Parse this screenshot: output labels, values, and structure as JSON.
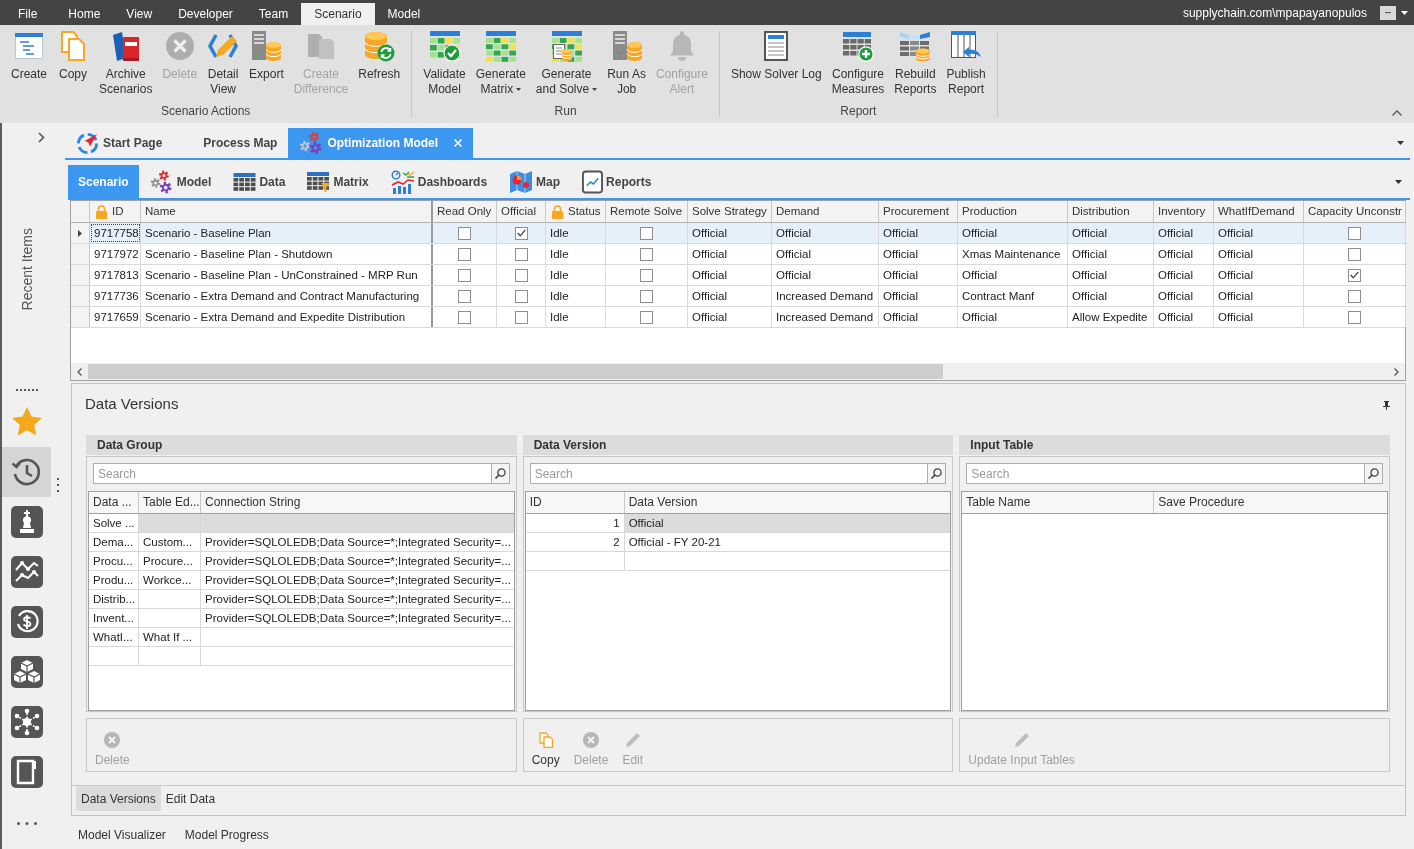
{
  "menu_bar": {
    "items": [
      {
        "label": "File",
        "selected": false
      },
      {
        "label": "Home",
        "selected": false
      },
      {
        "label": "View",
        "selected": false
      },
      {
        "label": "Developer",
        "selected": false
      },
      {
        "label": "Team",
        "selected": false
      },
      {
        "label": "Scenario",
        "selected": true
      },
      {
        "label": "Model",
        "selected": false
      }
    ],
    "user": "supplychain.com\\mpapayanopulos",
    "user_menu": "--"
  },
  "ribbon": {
    "groups": [
      {
        "label": "Scenario Actions",
        "buttons": [
          {
            "label": "Create",
            "disabled": false,
            "dropdown": false
          },
          {
            "label": "Copy",
            "disabled": false,
            "dropdown": false
          },
          {
            "label": "Archive\nScenarios",
            "disabled": false,
            "dropdown": false
          },
          {
            "label": "Delete",
            "disabled": true,
            "dropdown": false
          },
          {
            "label": "Detail\nView",
            "disabled": false,
            "dropdown": false
          },
          {
            "label": "Export",
            "disabled": false,
            "dropdown": false
          },
          {
            "label": "Create\nDifference",
            "disabled": true,
            "dropdown": false
          },
          {
            "label": "Refresh",
            "disabled": false,
            "dropdown": false
          }
        ]
      },
      {
        "label": "Run",
        "buttons": [
          {
            "label": "Validate\nModel",
            "disabled": false,
            "dropdown": false
          },
          {
            "label": "Generate\nMatrix",
            "disabled": false,
            "dropdown": true
          },
          {
            "label": "Generate\nand Solve",
            "disabled": false,
            "dropdown": true
          },
          {
            "label": "Run As\nJob",
            "disabled": false,
            "dropdown": false
          },
          {
            "label": "Configure\nAlert",
            "disabled": true,
            "dropdown": false
          }
        ]
      },
      {
        "label": "Report",
        "buttons": [
          {
            "label": "Show Solver Log",
            "disabled": false,
            "dropdown": false
          },
          {
            "label": "Configure\nMeasures",
            "disabled": false,
            "dropdown": false
          },
          {
            "label": "Rebuild\nReports",
            "disabled": false,
            "dropdown": false
          },
          {
            "label": "Publish\nReport",
            "disabled": false,
            "dropdown": false
          }
        ]
      }
    ]
  },
  "sidebar": {
    "label": "Recent Items",
    "items": [
      {
        "selected": false
      },
      {
        "selected": true
      },
      {
        "selected": false
      },
      {
        "selected": false
      },
      {
        "selected": false
      },
      {
        "selected": false
      },
      {
        "selected": false
      },
      {
        "selected": false
      }
    ]
  },
  "document_tabs": [
    {
      "label": "Start Page",
      "selected": false,
      "closable": false
    },
    {
      "label": "Process Map",
      "selected": false,
      "closable": false
    },
    {
      "label": "Optimization Model",
      "selected": true,
      "closable": true
    }
  ],
  "view_tabs": [
    {
      "label": "Scenario",
      "selected": true
    },
    {
      "label": "Model",
      "selected": false
    },
    {
      "label": "Data",
      "selected": false
    },
    {
      "label": "Matrix",
      "selected": false
    },
    {
      "label": "Dashboards",
      "selected": false
    },
    {
      "label": "Map",
      "selected": false
    },
    {
      "label": "Reports",
      "selected": false
    }
  ],
  "scenario_grid": {
    "columns": [
      {
        "label": "ID",
        "kind": "text",
        "locked": true
      },
      {
        "label": "Name",
        "kind": "text",
        "locked": false
      },
      {
        "label": "Read Only",
        "kind": "check",
        "locked": false
      },
      {
        "label": "Official",
        "kind": "check",
        "locked": false
      },
      {
        "label": "Status",
        "kind": "text",
        "locked": true
      },
      {
        "label": "Remote Solve",
        "kind": "check",
        "locked": false
      },
      {
        "label": "Solve Strategy",
        "kind": "text",
        "locked": false
      },
      {
        "label": "Demand",
        "kind": "text",
        "locked": false
      },
      {
        "label": "Procurement",
        "kind": "text",
        "locked": false
      },
      {
        "label": "Production",
        "kind": "text",
        "locked": false
      },
      {
        "label": "Distribution",
        "kind": "text",
        "locked": false
      },
      {
        "label": "Inventory",
        "kind": "text",
        "locked": false
      },
      {
        "label": "WhatIfDemand",
        "kind": "text",
        "locked": false
      },
      {
        "label": "Capacity Unconstr",
        "kind": "check",
        "locked": false
      }
    ],
    "rows": [
      {
        "selected": true,
        "cells": [
          "9717758",
          "Scenario - Baseline Plan",
          {
            "checked": false
          },
          {
            "checked": true
          },
          "Idle",
          {
            "checked": false
          },
          "Official",
          "Official",
          "Official",
          "Official",
          "Official",
          "Official",
          "Official",
          {
            "checked": false
          }
        ]
      },
      {
        "selected": false,
        "cells": [
          "9717972",
          "Scenario - Baseline Plan - Shutdown",
          {
            "checked": false
          },
          {
            "checked": false
          },
          "Idle",
          {
            "checked": false
          },
          "Official",
          "Official",
          "Official",
          "Xmas Maintenance",
          "Official",
          "Official",
          "Official",
          {
            "checked": false
          }
        ]
      },
      {
        "selected": false,
        "cells": [
          "9717813",
          "Scenario - Baseline Plan - UnConstrained - MRP Run",
          {
            "checked": false
          },
          {
            "checked": false
          },
          "Idle",
          {
            "checked": false
          },
          "Official",
          "Official",
          "Official",
          "Official",
          "Official",
          "Official",
          "Official",
          {
            "checked": true
          }
        ]
      },
      {
        "selected": false,
        "cells": [
          "9717736",
          "Scenario - Extra Demand and Contract Manufacturing",
          {
            "checked": false
          },
          {
            "checked": false
          },
          "Idle",
          {
            "checked": false
          },
          "Official",
          "Increased Demand",
          "Official",
          "Contract Manf",
          "Official",
          "Official",
          "Official",
          {
            "checked": false
          }
        ]
      },
      {
        "selected": false,
        "cells": [
          "9717659",
          "Scenario - Extra Demand and Expedite Distribution",
          {
            "checked": false
          },
          {
            "checked": false
          },
          "Idle",
          {
            "checked": false
          },
          "Official",
          "Increased Demand",
          "Official",
          "Official",
          "Allow Expedite",
          "Official",
          "Official",
          {
            "checked": false
          }
        ]
      }
    ]
  },
  "data_versions": {
    "title": "Data Versions",
    "panels": [
      {
        "title": "Data Group",
        "search": {
          "placeholder": "Search"
        },
        "columns": [
          "Data ...",
          "Table Ed...",
          "Connection String"
        ],
        "rows": [
          {
            "selected": true,
            "cells": [
              "Solve ...",
              null,
              null
            ]
          },
          {
            "selected": false,
            "cells": [
              "Dema...",
              "Custom...",
              "Provider=SQLOLEDB;Data Source=*;Integrated Security=..."
            ]
          },
          {
            "selected": false,
            "cells": [
              "Procu...",
              "Procure...",
              "Provider=SQLOLEDB;Data Source=*;Integrated Security=..."
            ]
          },
          {
            "selected": false,
            "cells": [
              "Produ...",
              "Workce...",
              "Provider=SQLOLEDB;Data Source=*;Integrated Security=..."
            ]
          },
          {
            "selected": false,
            "cells": [
              "Distrib...",
              null,
              "Provider=SQLOLEDB;Data Source=*;Integrated Security=..."
            ]
          },
          {
            "selected": false,
            "cells": [
              "Invent...",
              null,
              "Provider=SQLOLEDB;Data Source=*;Integrated Security=..."
            ]
          },
          {
            "selected": false,
            "cells": [
              "WhatI...",
              "What If ...",
              null
            ]
          }
        ],
        "actions": [
          {
            "label": "Delete",
            "kind": "delete",
            "disabled": true
          }
        ]
      },
      {
        "title": "Data Version",
        "search": {
          "placeholder": "Search"
        },
        "columns": [
          "ID",
          "Data Version"
        ],
        "rows": [
          {
            "selected": true,
            "cells": [
              "1",
              "Official"
            ]
          },
          {
            "selected": false,
            "cells": [
              "2",
              "Official - FY 20-21"
            ]
          }
        ],
        "actions": [
          {
            "label": "Copy",
            "kind": "copy",
            "disabled": false
          },
          {
            "label": "Delete",
            "kind": "delete",
            "disabled": true
          },
          {
            "label": "Edit",
            "kind": "edit",
            "disabled": true
          }
        ]
      },
      {
        "title": "Input Table",
        "search": {
          "placeholder": "Search"
        },
        "columns": [
          "Table Name",
          "Save Procedure"
        ],
        "actions": [
          {
            "label": "Update Input Tables",
            "kind": "edit",
            "disabled": true
          }
        ]
      }
    ],
    "tabs": [
      {
        "label": "Data Versions",
        "selected": true
      },
      {
        "label": "Edit Data",
        "selected": false
      }
    ]
  },
  "bottom_tabs": [
    {
      "label": "Model Visualizer",
      "selected": false
    },
    {
      "label": "Model Progress",
      "selected": false
    }
  ]
}
